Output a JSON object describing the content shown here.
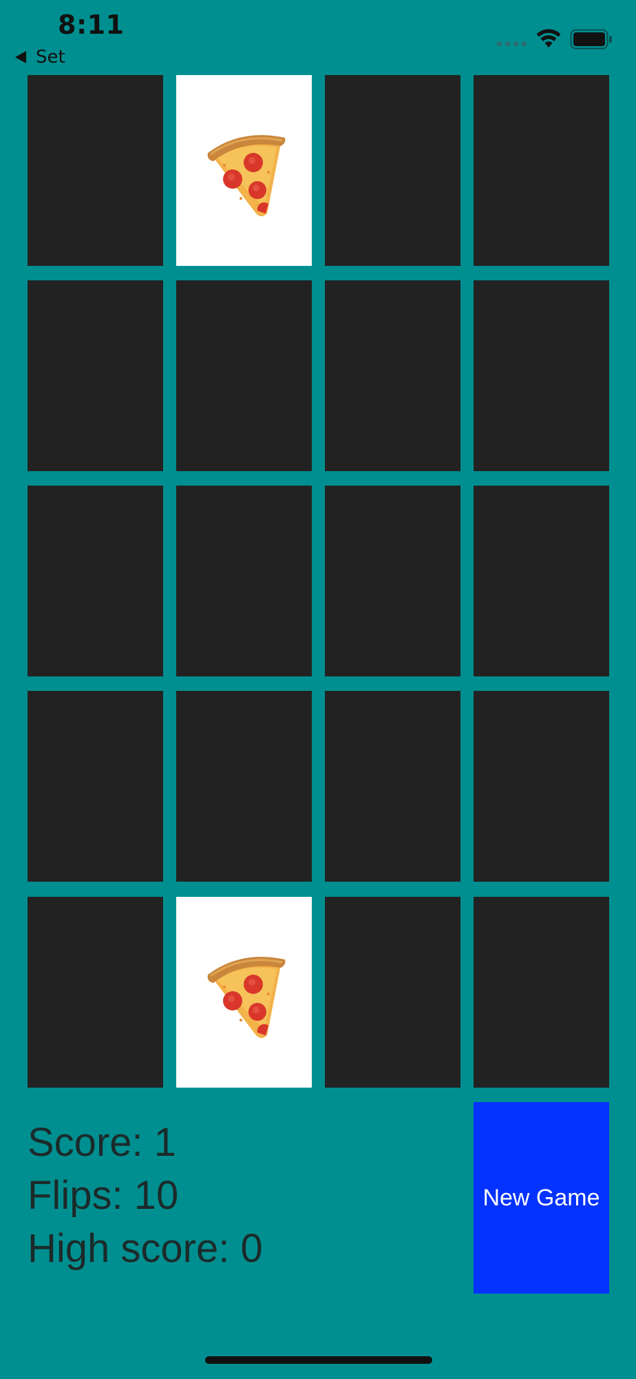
{
  "status_bar": {
    "time": "8:11",
    "back_label": "Set",
    "wifi_icon": "wifi-icon",
    "battery_icon": "battery-icon",
    "signal_icon": "cellular-signal-icon"
  },
  "colors": {
    "background": "#008f90",
    "card_back": "#222222",
    "card_face": "#ffffff",
    "button": "#0433ff"
  },
  "board": {
    "rows": 5,
    "columns": 4,
    "cards": [
      {
        "face_up": false,
        "emoji": ""
      },
      {
        "face_up": true,
        "emoji": "pizza"
      },
      {
        "face_up": false,
        "emoji": ""
      },
      {
        "face_up": false,
        "emoji": ""
      },
      {
        "face_up": false,
        "emoji": ""
      },
      {
        "face_up": false,
        "emoji": ""
      },
      {
        "face_up": false,
        "emoji": ""
      },
      {
        "face_up": false,
        "emoji": ""
      },
      {
        "face_up": false,
        "emoji": ""
      },
      {
        "face_up": false,
        "emoji": ""
      },
      {
        "face_up": false,
        "emoji": ""
      },
      {
        "face_up": false,
        "emoji": ""
      },
      {
        "face_up": false,
        "emoji": ""
      },
      {
        "face_up": false,
        "emoji": ""
      },
      {
        "face_up": false,
        "emoji": ""
      },
      {
        "face_up": false,
        "emoji": ""
      },
      {
        "face_up": false,
        "emoji": ""
      },
      {
        "face_up": true,
        "emoji": "pizza"
      },
      {
        "face_up": false,
        "emoji": ""
      },
      {
        "face_up": false,
        "emoji": ""
      }
    ]
  },
  "stats": {
    "score": "Score: 1",
    "flips": "Flips: 10",
    "high_score": "High score: 0"
  },
  "new_game_label": "New Game"
}
